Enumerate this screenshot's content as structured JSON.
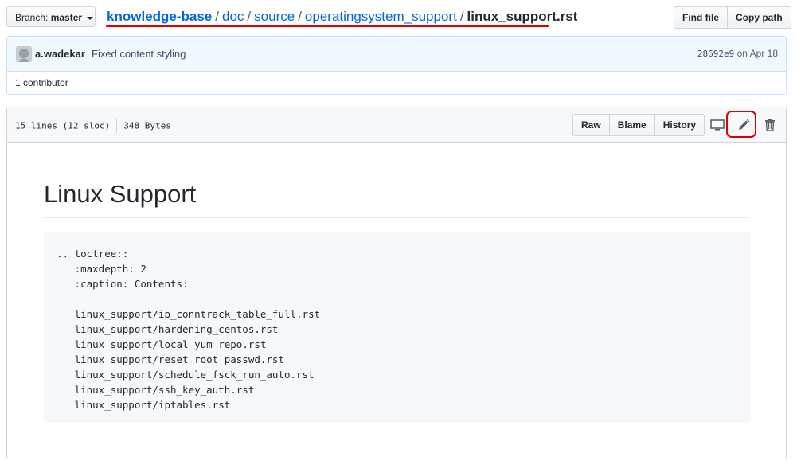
{
  "branch": {
    "prefix": "Branch:",
    "name": "master"
  },
  "breadcrumb": {
    "root": "knowledge-base",
    "parts": [
      "doc",
      "source",
      "operatingsystem_support"
    ],
    "separator": "/",
    "final": "linux_support.rst"
  },
  "top_buttons": {
    "find_file": "Find file",
    "copy_path": "Copy path"
  },
  "commit": {
    "author": "a.wadekar",
    "message": "Fixed content styling",
    "sha": "28692e9",
    "date": "on Apr 18"
  },
  "contributors": "1 contributor",
  "file": {
    "lines": "15 lines (12 sloc)",
    "size": "348 Bytes",
    "actions": {
      "raw": "Raw",
      "blame": "Blame",
      "history": "History"
    },
    "icons": [
      "desktop-icon",
      "pencil-icon",
      "trash-icon"
    ]
  },
  "readme": {
    "title": "Linux Support",
    "code": ".. toctree::\n   :maxdepth: 2\n   :caption: Contents:\n\n   linux_support/ip_conntrack_table_full.rst\n   linux_support/hardening_centos.rst\n   linux_support/local_yum_repo.rst\n   linux_support/reset_root_passwd.rst\n   linux_support/schedule_fsck_run_auto.rst\n   linux_support/ssh_key_auth.rst\n   linux_support/iptables.rst"
  },
  "colors": {
    "link": "#0366d6",
    "highlight": "#e00000",
    "commit_bg": "#f1f8ff"
  }
}
